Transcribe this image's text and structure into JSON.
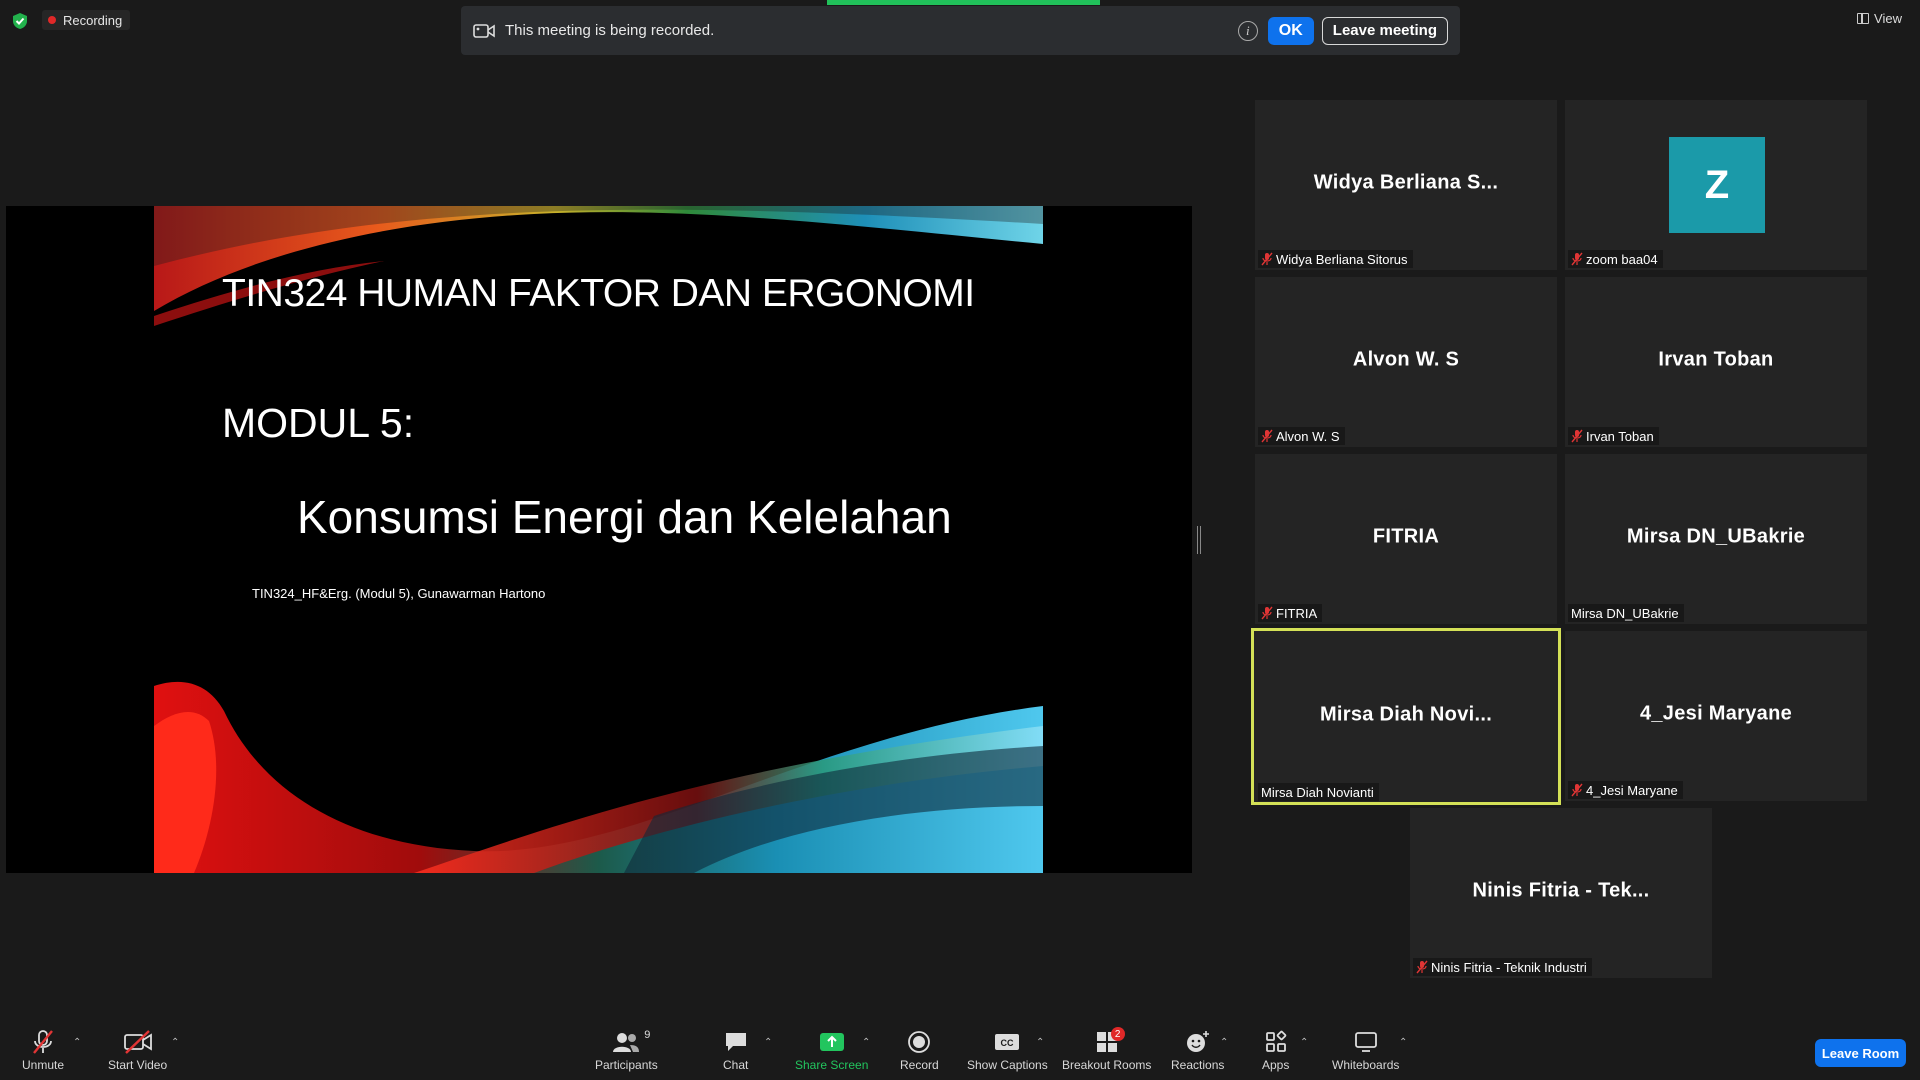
{
  "recording": {
    "label": "Recording"
  },
  "banner": {
    "text": "This meeting is being recorded.",
    "ok_label": "OK",
    "leave_label": "Leave meeting"
  },
  "view": {
    "label": "View"
  },
  "slide": {
    "title": "TIN324 HUMAN FAKTOR DAN ERGONOMI",
    "module": "MODUL 5:",
    "subtitle": "Konsumsi Energi dan  Kelelahan",
    "credit": "TIN324_HF&Erg. (Modul 5), Gunawarman Hartono"
  },
  "tiles": [
    {
      "display": "Widya  Berliana  S...",
      "label": "Widya Berliana Sitorus",
      "muted": true
    },
    {
      "display": "",
      "avatar_letter": "Z",
      "label": "zoom baa04",
      "muted": true
    },
    {
      "display": "Alvon  W. S",
      "label": "Alvon W. S",
      "muted": true
    },
    {
      "display": "Irvan  Toban",
      "label": "Irvan Toban",
      "muted": true
    },
    {
      "display": "FITRIA",
      "label": "FITRIA",
      "muted": true
    },
    {
      "display": "Mirsa  DN_UBakrie",
      "label": "Mirsa DN_UBakrie",
      "muted": false
    },
    {
      "display": "Mirsa  Diah  Novi...",
      "label": "Mirsa Diah Novianti",
      "muted": false,
      "active": true
    },
    {
      "display": "4_Jesi  Maryane",
      "label": "4_Jesi Maryane",
      "muted": true
    },
    {
      "display": "Ninis  Fitria  -  Tek...",
      "label": "Ninis Fitria - Teknik Industri",
      "muted": true
    }
  ],
  "toolbar": {
    "unmute": "Unmute",
    "start_video": "Start Video",
    "participants": "Participants",
    "participants_count": "9",
    "chat": "Chat",
    "share_screen": "Share Screen",
    "record": "Record",
    "show_captions": "Show Captions",
    "breakout_rooms": "Breakout Rooms",
    "breakout_badge": "2",
    "reactions": "Reactions",
    "apps": "Apps",
    "whiteboards": "Whiteboards",
    "leave_room": "Leave Room"
  },
  "colors": {
    "accent": "#0e72ed",
    "active_speaker": "#d4e157",
    "share_green": "#22c55e",
    "avatar": "#1b9aa9"
  }
}
